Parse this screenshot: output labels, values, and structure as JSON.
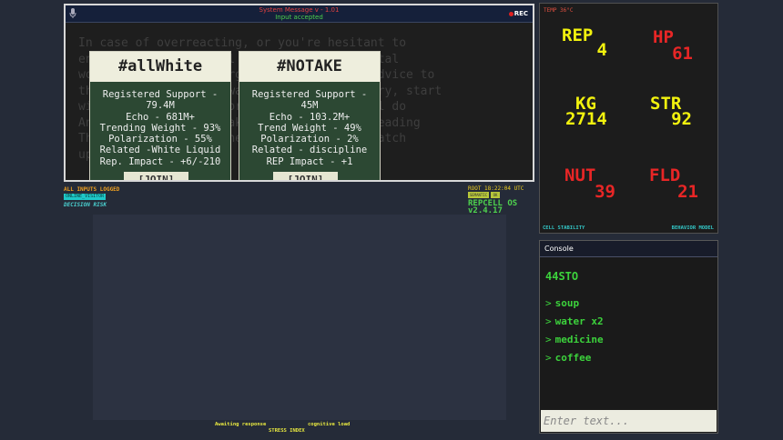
{
  "window": {
    "title": "System Message v - 1.01",
    "subtitle": "Input accepted",
    "rec_label": "REC",
    "background_text": "In case of overreacting, or you're hesitant to\nengage, on an external platform-paced digital\nworld it's easy to forget. That's why my advice to\nthis hike, and walk away, it's all necessary, start\nwith a short book, short graphic books will do\nAny lifelong habit, take up the habit of reading\nThe classic, Not online but [SUM]. let's catch\nup with a"
  },
  "cards": [
    {
      "hashtag": "#allWhite",
      "lines": [
        "Registered Support -",
        "79.4M",
        "Echo - 681M+",
        "Trending Weight - 93%",
        "Polarization - 55%",
        "Related -White Liquid",
        "Rep. Impact - +6/-210"
      ],
      "join_label": "[JOIN]"
    },
    {
      "hashtag": "#NOTAKE",
      "lines": [
        "Registered Support -",
        "45M",
        "Echo - 103.2M+",
        "Trend Weight - 49%",
        "Polarization - 2%",
        "Related - discipline",
        "REP Impact - +1"
      ],
      "join_label": "[JOIN]"
    }
  ],
  "status": {
    "inputs_logged": "ALL INPUTS LOGGED",
    "online_badge": "ONLINE_VISITOR",
    "decision_risk": "DECISION RISK",
    "root_time": "ROOT 18:22:04 UTC",
    "badge_a": "SEMANTIC",
    "badge_b": "OK",
    "os_name": "REPCELL OS",
    "os_version": "v2.4.17"
  },
  "bottom": {
    "awaiting": "Awaiting response",
    "cognitive": "cognitive load",
    "stress": "STRESS INDEX"
  },
  "stats": {
    "temp": "TEMP 36°C",
    "rep_label": "REP",
    "rep_value": "4",
    "hp_label": "HP",
    "hp_value": "61",
    "kg_label": "KG",
    "kg_value": "2714",
    "str_label": "STR",
    "str_value": "92",
    "nut_label": "NUT",
    "nut_value": "39",
    "fld_label": "FLD",
    "fld_value": "21",
    "cell_stability": "CELL STABILITY",
    "behavior_model": "BEHAVIOR MODEL"
  },
  "console": {
    "title": "Console",
    "balance": "44STO",
    "prompt": ">",
    "items": [
      "soup",
      "water x2",
      "medicine",
      "coffee"
    ],
    "placeholder": "Enter text..."
  },
  "colors": {
    "accent_green": "#3cd23c",
    "alert_red": "#e82626",
    "stat_yellow": "#f2f20e",
    "card_green": "#2c4833"
  }
}
